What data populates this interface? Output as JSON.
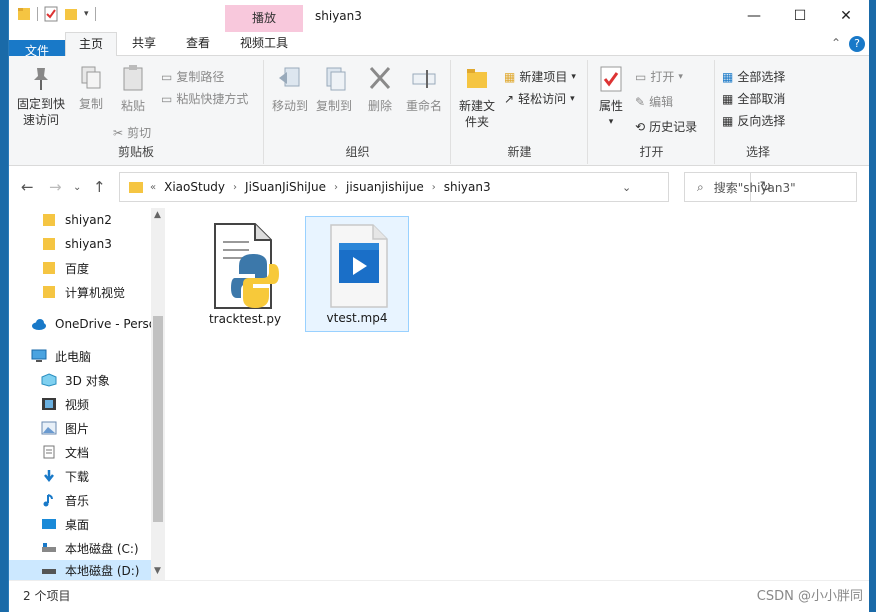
{
  "window": {
    "title": "shiyan3",
    "context_tab": "播放",
    "minimize": "—",
    "maximize": "☐",
    "close": "✕"
  },
  "tabs": {
    "file": "文件",
    "home": "主页",
    "share": "共享",
    "view": "查看",
    "video_tools": "视频工具"
  },
  "ribbon": {
    "clipboard": {
      "label": "剪贴板",
      "pin": "固定到快速访问",
      "copy": "复制",
      "paste": "粘贴",
      "copy_path": "复制路径",
      "paste_shortcut": "粘贴快捷方式",
      "cut": "剪切"
    },
    "organize": {
      "label": "组织",
      "move_to": "移动到",
      "copy_to": "复制到",
      "delete": "删除",
      "rename": "重命名"
    },
    "new": {
      "label": "新建",
      "new_folder": "新建文件夹",
      "new_item": "新建项目",
      "easy_access": "轻松访问"
    },
    "open": {
      "label": "打开",
      "properties": "属性",
      "open": "打开",
      "edit": "编辑",
      "history": "历史记录"
    },
    "select": {
      "label": "选择",
      "select_all": "全部选择",
      "select_none": "全部取消",
      "invert": "反向选择"
    }
  },
  "address": {
    "prefix": "«",
    "crumbs": [
      "XiaoStudy",
      "JiSuanJiShiJue",
      "jisuanjishijue",
      "shiyan3"
    ],
    "search_placeholder": "搜索\"shiyan3\""
  },
  "nav": {
    "items": [
      {
        "label": "shiyan2",
        "icon": "folder-icon"
      },
      {
        "label": "shiyan3",
        "icon": "folder-icon"
      },
      {
        "label": "百度",
        "icon": "folder-icon"
      },
      {
        "label": "计算机视觉",
        "icon": "folder-icon"
      },
      {
        "label": "OneDrive - Perso",
        "icon": "cloud-icon"
      },
      {
        "label": "此电脑",
        "icon": "pc-icon"
      },
      {
        "label": "3D 对象",
        "icon": "cube-icon"
      },
      {
        "label": "视频",
        "icon": "video-icon"
      },
      {
        "label": "图片",
        "icon": "picture-icon"
      },
      {
        "label": "文档",
        "icon": "document-icon"
      },
      {
        "label": "下载",
        "icon": "download-icon"
      },
      {
        "label": "音乐",
        "icon": "music-icon"
      },
      {
        "label": "桌面",
        "icon": "desktop-icon"
      },
      {
        "label": "本地磁盘 (C:)",
        "icon": "drive-icon"
      },
      {
        "label": "本地磁盘 (D:)",
        "icon": "drive-icon"
      }
    ]
  },
  "files": [
    {
      "name": "tracktest.py",
      "icon": "python-file-icon"
    },
    {
      "name": "vtest.mp4",
      "icon": "video-file-icon"
    }
  ],
  "status": {
    "count": "2 个项目",
    "watermark": "CSDN @小小胖同"
  },
  "colors": {
    "accent": "#1979c8",
    "context_tab": "#f8c8dc",
    "selection": "#cce8ff",
    "folder": "#f5c542"
  }
}
